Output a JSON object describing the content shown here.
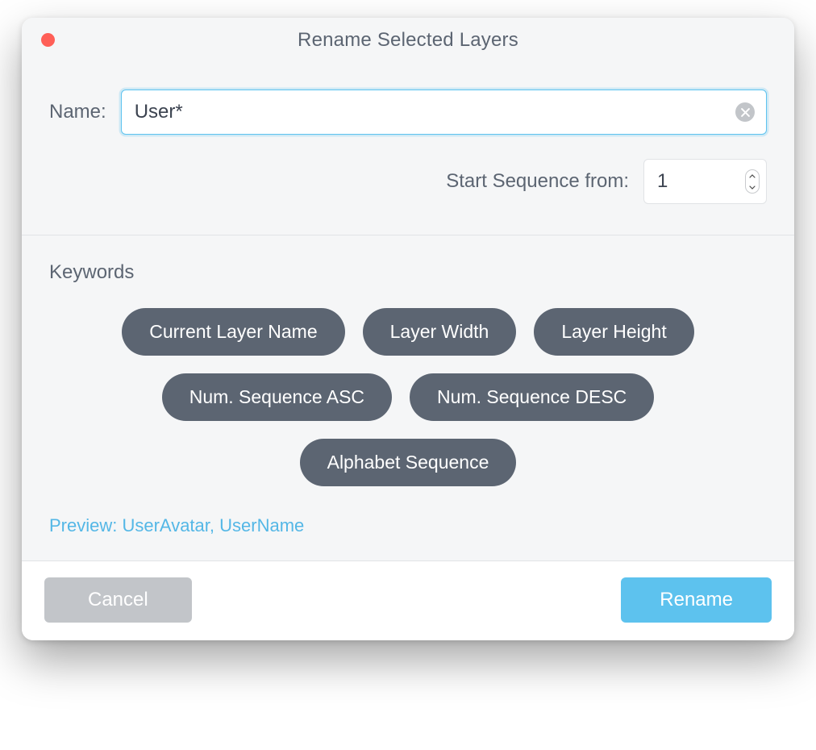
{
  "dialog": {
    "title": "Rename Selected Layers",
    "name_label": "Name:",
    "name_value": "User*",
    "sequence_label": "Start Sequence from:",
    "sequence_value": "1"
  },
  "keywords": {
    "label": "Keywords",
    "pills": [
      "Current Layer Name",
      "Layer Width",
      "Layer Height",
      "Num. Sequence ASC",
      "Num. Sequence DESC",
      "Alphabet Sequence"
    ]
  },
  "preview": "Preview: UserAvatar, UserName",
  "footer": {
    "cancel": "Cancel",
    "rename": "Rename"
  }
}
